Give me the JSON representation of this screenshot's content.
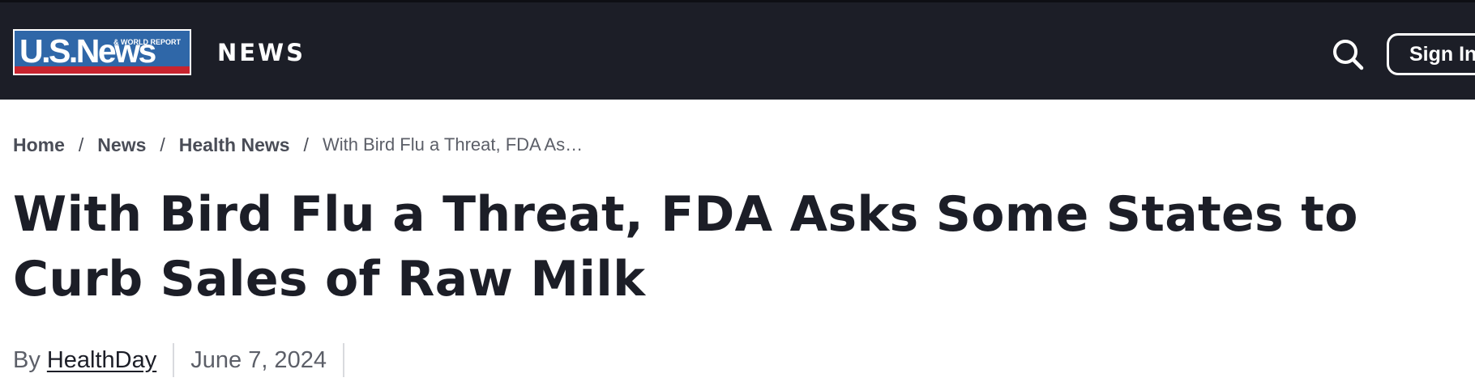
{
  "header": {
    "logo": {
      "wordmark": "U.S.News",
      "subtext": "& WORLD REPORT"
    },
    "section_name": "NEWS",
    "search_icon": "search-icon",
    "signin_label": "Sign In",
    "colors": {
      "background": "#1c1e27",
      "logo_blue": "#2f67a8",
      "logo_red": "#c8242e"
    }
  },
  "breadcrumb": {
    "items": [
      "Home",
      "News",
      "Health News"
    ],
    "separator": "/",
    "current": "With Bird Flu a Threat, FDA As…"
  },
  "article": {
    "title": "With Bird Flu a Threat, FDA Asks Some States to Curb Sales of Raw Milk",
    "byline_prefix": "By",
    "author": "HealthDay",
    "date": "June 7, 2024"
  }
}
